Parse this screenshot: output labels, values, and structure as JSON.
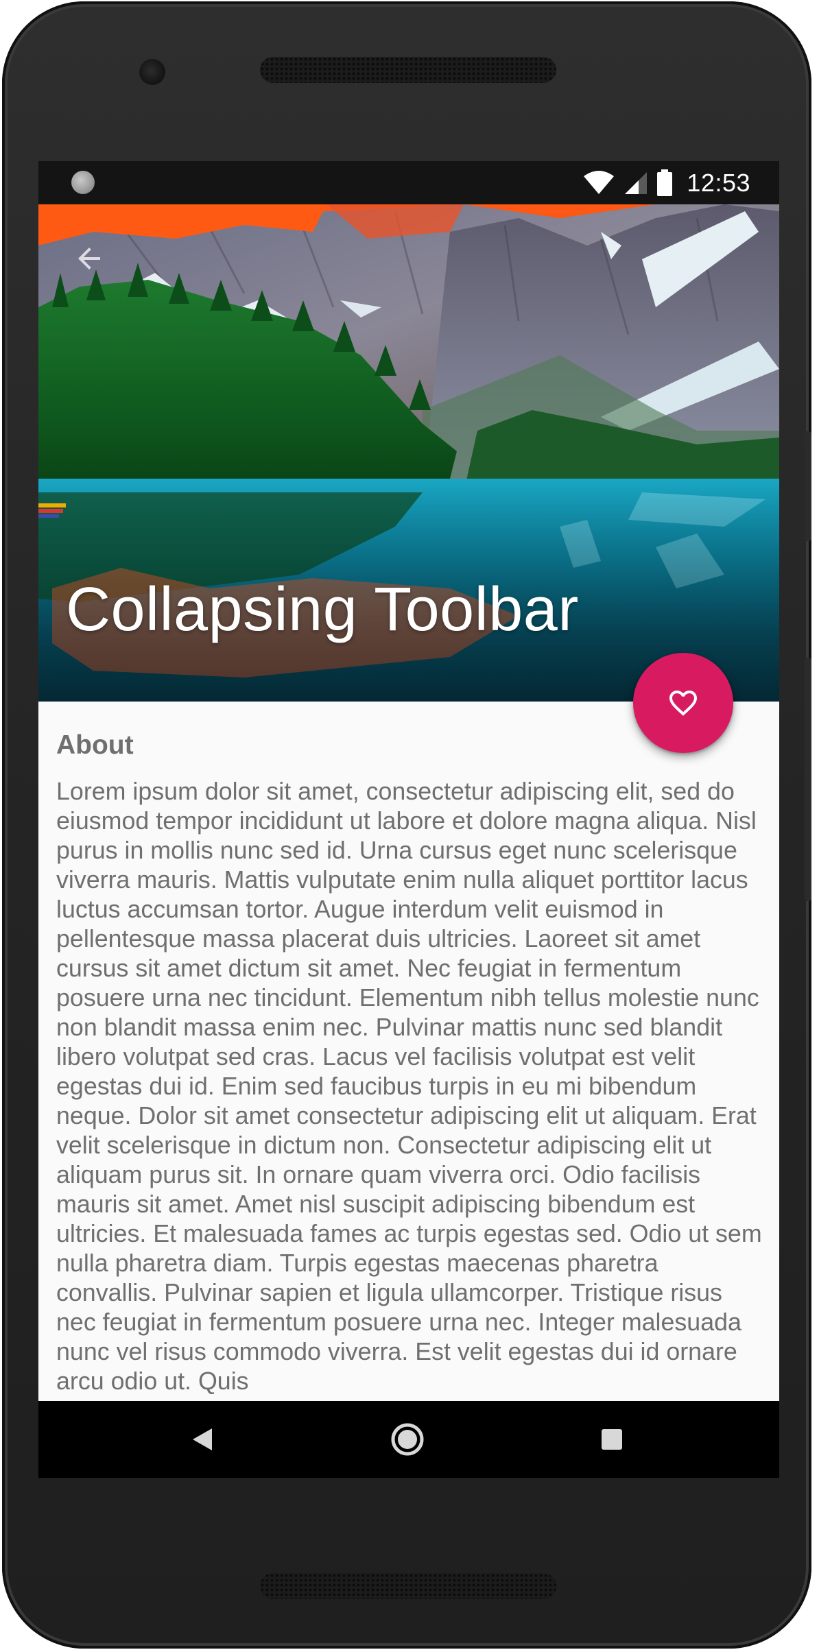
{
  "status_bar": {
    "time": "12:53",
    "icons": [
      "notification-dot-icon",
      "wifi-icon",
      "cell-signal-icon",
      "battery-icon"
    ]
  },
  "toolbar": {
    "title": "Collapsing Toolbar",
    "back_icon": "arrow-back-icon"
  },
  "fab": {
    "icon": "heart-outline-icon",
    "color": "#d81b60"
  },
  "content": {
    "heading": "About",
    "body": "Lorem ipsum dolor sit amet, consectetur adipiscing elit, sed do eiusmod tempor incididunt ut labore et dolore magna aliqua. Nisl purus in mollis nunc sed id. Urna cursus eget nunc scelerisque viverra mauris. Mattis vulputate enim nulla aliquet porttitor lacus luctus accumsan tortor. Augue interdum velit euismod in pellentesque massa placerat duis ultricies. Laoreet sit amet cursus sit amet dictum sit amet. Nec feugiat in fermentum posuere urna nec tincidunt. Elementum nibh tellus molestie nunc non blandit massa enim nec. Pulvinar mattis nunc sed blandit libero volutpat sed cras. Lacus vel facilisis volutpat est velit egestas dui id. Enim sed faucibus turpis in eu mi bibendum neque. Dolor sit amet consectetur adipiscing elit ut aliquam. Erat velit scelerisque in dictum non. Consectetur adipiscing elit ut aliquam purus sit. In ornare quam viverra orci. Odio facilisis mauris sit amet. Amet nisl suscipit adipiscing bibendum est ultricies. Et malesuada fames ac turpis egestas sed. Odio ut sem nulla pharetra diam. Turpis egestas maecenas pharetra convallis. Pulvinar sapien et ligula ullamcorper. Tristique risus nec feugiat in fermentum posuere urna nec. Integer malesuada nunc vel risus commodo viverra. Est velit egestas dui id ornare arcu odio ut. Quis"
  },
  "nav_bar": {
    "icons": [
      "nav-back-icon",
      "nav-home-icon",
      "nav-recents-icon"
    ]
  },
  "colors": {
    "accent": "#d81b60",
    "status_bar": "#141414",
    "nav_bar": "#000000",
    "text": "#6f6f6f",
    "background": "#fafafa"
  }
}
